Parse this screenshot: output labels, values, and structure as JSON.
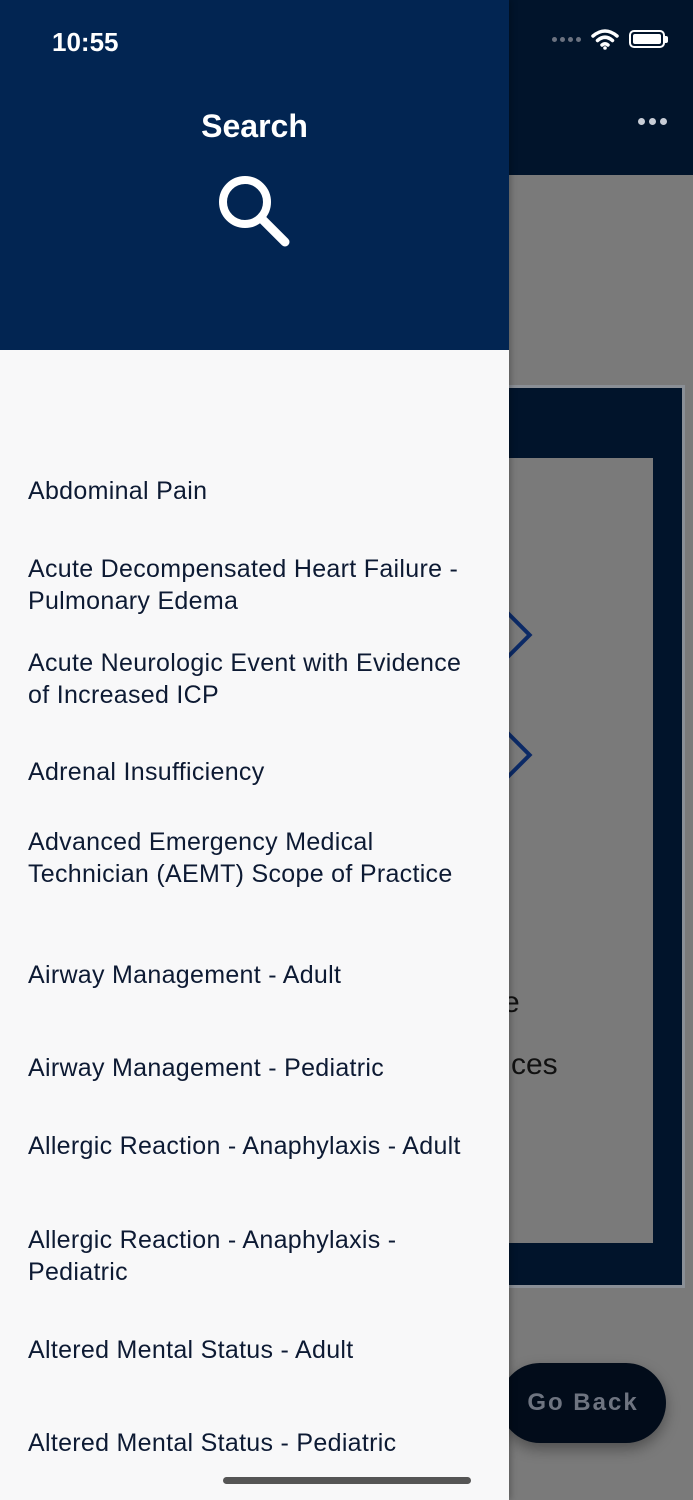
{
  "status_bar": {
    "time": "10:55"
  },
  "drawer": {
    "title": "Search",
    "items": [
      "Abdominal Pain",
      "Acute Decompensated Heart Failure - Pulmonary Edema",
      "Acute Neurologic Event with Evidence of Increased ICP",
      "Adrenal Insufficiency",
      "Advanced Emergency Medical Technician (AEMT) Scope of Practice",
      "Airway Management - Adult",
      "Airway Management - Pediatric",
      "Allergic Reaction - Anaphylaxis - Adult",
      "Allergic Reaction - Anaphylaxis - Pediatric",
      "Altered Mental Status - Adult",
      "Altered Mental Status - Pediatric"
    ]
  },
  "background": {
    "text_fragments": [
      "e",
      "ces"
    ],
    "go_back_label": "Go Back"
  },
  "icons": {
    "search": "search-icon",
    "more": "more-icon",
    "wifi": "wifi-icon",
    "battery": "battery-icon"
  },
  "colors": {
    "drawer_header": "#022552",
    "app_header": "#01142b",
    "list_text": "#0d1a33"
  }
}
